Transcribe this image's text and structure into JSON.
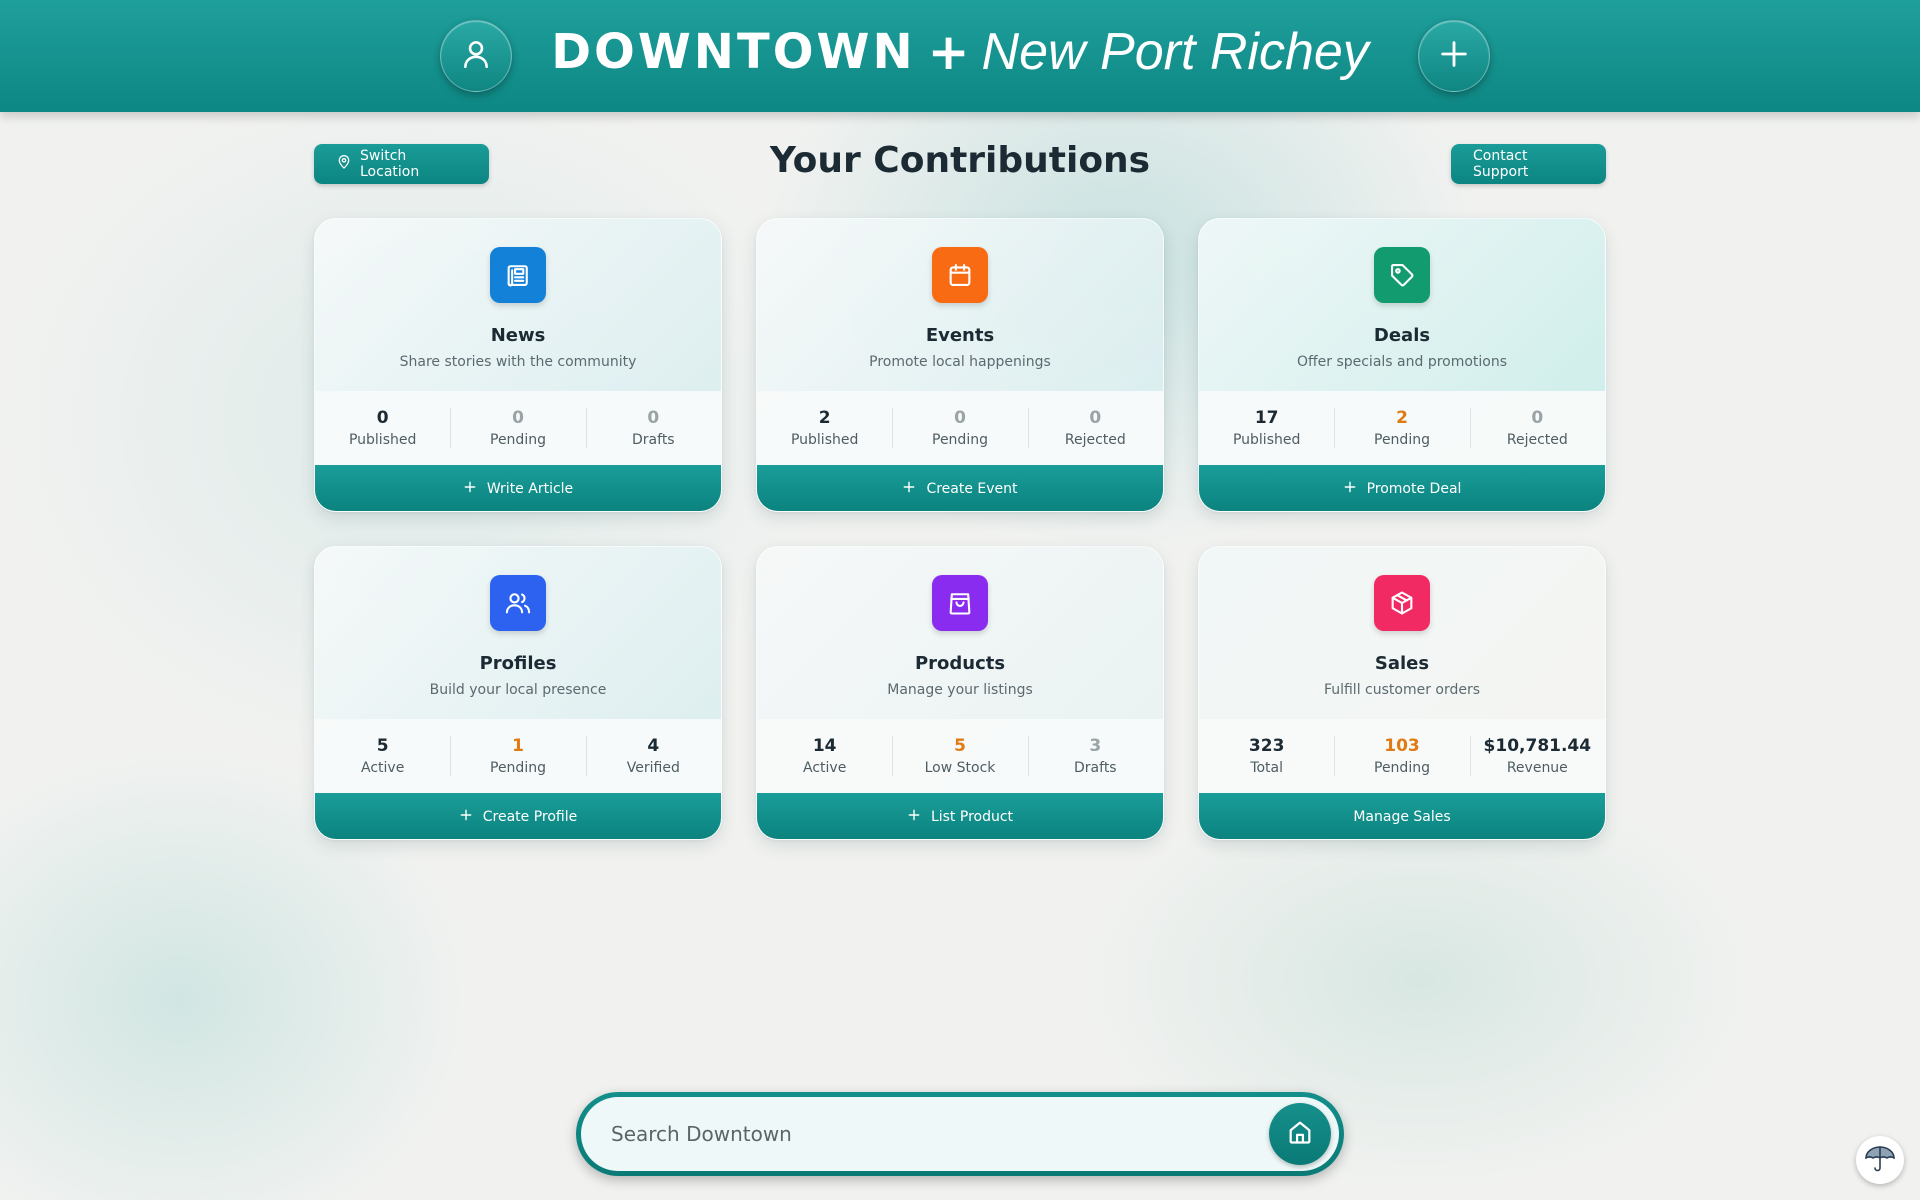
{
  "header": {
    "brand_main": "DOWNTOWN",
    "brand_plus": "+",
    "brand_city": "New Port Richey",
    "profile_icon": "user-icon",
    "add_icon": "plus-icon"
  },
  "toolbar": {
    "switch_location_label": "Switch Location",
    "switch_location_icon": "map-pin-icon",
    "contact_support_label": "Contact Support"
  },
  "page_title": "Your Contributions",
  "colors": {
    "brand_teal": "#0d8783",
    "news": "#1481d8",
    "events": "#f86b12",
    "deals": "#119b6e",
    "profiles": "#2d62f0",
    "products": "#8a2cf0",
    "sales": "#f22a63",
    "pending_orange": "#e07a12",
    "muted_gray": "#9aa3a6"
  },
  "cards": [
    {
      "title": "News",
      "subtitle": "Share stories with the community",
      "icon": "newspaper-icon",
      "stats": [
        {
          "value": "0",
          "label": "Published"
        },
        {
          "value": "0",
          "label": "Pending"
        },
        {
          "value": "0",
          "label": "Drafts"
        }
      ],
      "action": "Write Article"
    },
    {
      "title": "Events",
      "subtitle": "Promote local happenings",
      "icon": "calendar-icon",
      "stats": [
        {
          "value": "2",
          "label": "Published"
        },
        {
          "value": "0",
          "label": "Pending"
        },
        {
          "value": "0",
          "label": "Rejected"
        }
      ],
      "action": "Create Event"
    },
    {
      "title": "Deals",
      "subtitle": "Offer specials and promotions",
      "icon": "tag-icon",
      "stats": [
        {
          "value": "17",
          "label": "Published"
        },
        {
          "value": "2",
          "label": "Pending"
        },
        {
          "value": "0",
          "label": "Rejected"
        }
      ],
      "action": "Promote Deal"
    },
    {
      "title": "Profiles",
      "subtitle": "Build your local presence",
      "icon": "users-icon",
      "stats": [
        {
          "value": "5",
          "label": "Active"
        },
        {
          "value": "1",
          "label": "Pending"
        },
        {
          "value": "4",
          "label": "Verified"
        }
      ],
      "action": "Create Profile"
    },
    {
      "title": "Products",
      "subtitle": "Manage your listings",
      "icon": "shopping-bag-icon",
      "stats": [
        {
          "value": "14",
          "label": "Active"
        },
        {
          "value": "5",
          "label": "Low Stock"
        },
        {
          "value": "3",
          "label": "Drafts"
        }
      ],
      "action": "List Product"
    },
    {
      "title": "Sales",
      "subtitle": "Fulfill customer orders",
      "icon": "package-icon",
      "stats": [
        {
          "value": "323",
          "label": "Total"
        },
        {
          "value": "103",
          "label": "Pending"
        },
        {
          "value": "$10,781.44",
          "label": "Revenue"
        }
      ],
      "action": "Manage Sales"
    }
  ],
  "search": {
    "placeholder": "Search Downtown",
    "value": "",
    "button_icon": "home-icon"
  },
  "floating": {
    "icon": "umbrella-icon"
  }
}
